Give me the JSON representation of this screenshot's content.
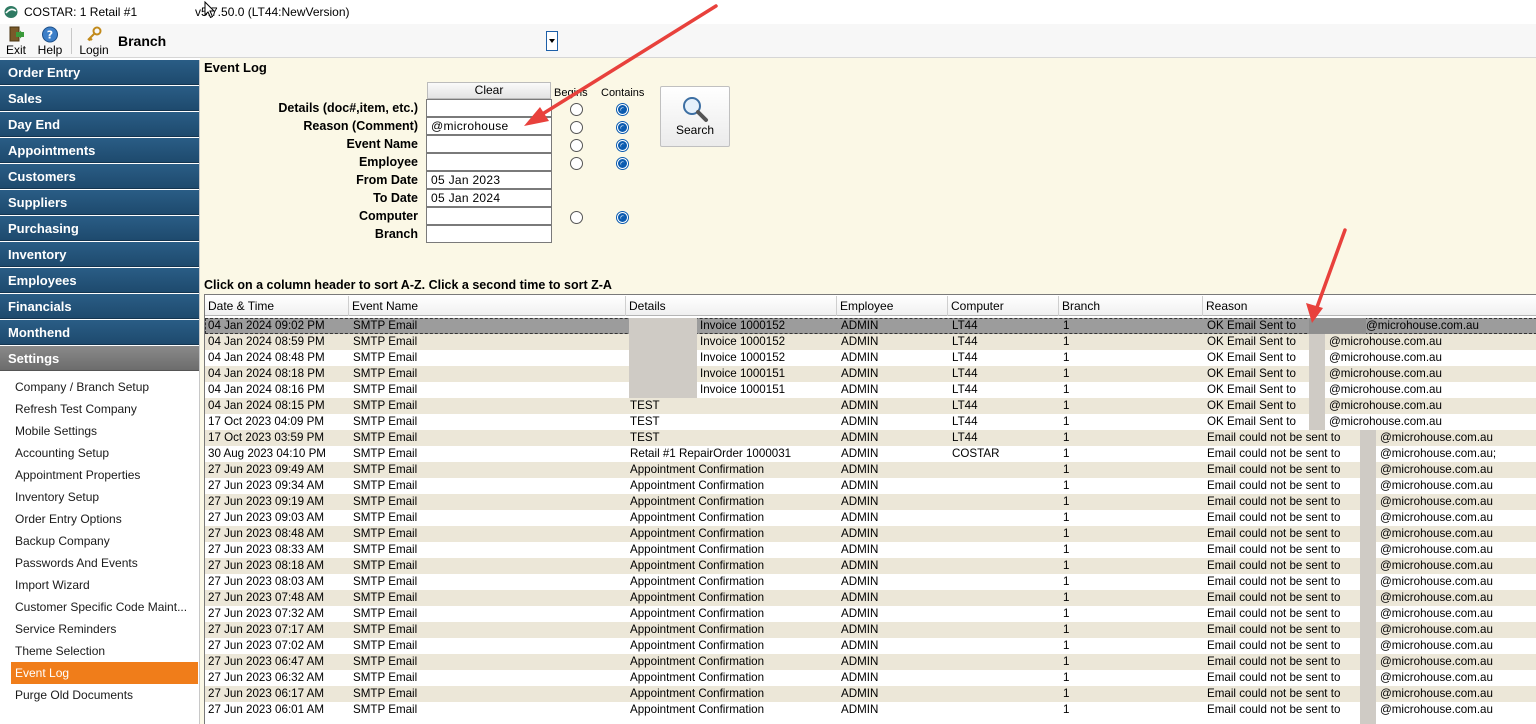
{
  "titlebar": {
    "app_name": "COSTAR:  1 Retail #1",
    "version": "v5.7.50.0  (LT44:NewVersion)"
  },
  "toolbar": {
    "exit_label": "Exit",
    "help_label": "Help",
    "login_label": "Login",
    "branch_label": "Branch"
  },
  "sidebar": {
    "headers": [
      {
        "label": "Order Entry"
      },
      {
        "label": "Sales"
      },
      {
        "label": "Day End"
      },
      {
        "label": "Appointments"
      },
      {
        "label": "Customers"
      },
      {
        "label": "Suppliers"
      },
      {
        "label": "Purchasing"
      },
      {
        "label": "Inventory"
      },
      {
        "label": "Employees"
      },
      {
        "label": "Financials"
      },
      {
        "label": "Monthend"
      },
      {
        "label": "Settings"
      }
    ],
    "settings_items": [
      {
        "label": "Company / Branch Setup"
      },
      {
        "label": "Refresh Test Company"
      },
      {
        "label": "Mobile Settings"
      },
      {
        "label": "Accounting Setup"
      },
      {
        "label": "Appointment Properties"
      },
      {
        "label": "Inventory Setup"
      },
      {
        "label": "Order Entry Options"
      },
      {
        "label": "Backup Company"
      },
      {
        "label": "Passwords And Events"
      },
      {
        "label": "Import Wizard"
      },
      {
        "label": "Customer Specific Code Maint..."
      },
      {
        "label": "Service Reminders"
      },
      {
        "label": "Theme Selection"
      },
      {
        "label": "Event Log"
      },
      {
        "label": "Purge Old Documents"
      }
    ]
  },
  "event_log": {
    "title": "Event Log",
    "clear_label": "Clear",
    "begins_label": "Begins",
    "contains_label": "Contains",
    "search_label": "Search",
    "fields": [
      {
        "label": "Details (doc#,item, etc.)",
        "value": ""
      },
      {
        "label": "Reason (Comment)",
        "value": "@microhouse"
      },
      {
        "label": "Event Name",
        "value": ""
      },
      {
        "label": "Employee",
        "value": ""
      },
      {
        "label": "From Date",
        "value": "05 Jan 2023"
      },
      {
        "label": "To Date",
        "value": "05 Jan 2024"
      },
      {
        "label": "Computer",
        "value": ""
      },
      {
        "label": "Branch",
        "value": ""
      }
    ],
    "sort_hint": "Click on a column header to sort A-Z.  Click a second time to sort Z-A"
  },
  "grid": {
    "columns": [
      "Date & Time",
      "Event Name",
      "Details",
      "Employee",
      "Computer",
      "Branch",
      "Reason"
    ],
    "rows": [
      [
        "04 Jan 2024 09:02 PM",
        "SMTP Email",
        "Invoice 1000152",
        "ADMIN",
        "LT44",
        "1",
        "OK Email Sent to",
        "@microhouse.com.au"
      ],
      [
        "04 Jan 2024 08:59 PM",
        "SMTP Email",
        "Invoice 1000152",
        "ADMIN",
        "LT44",
        "1",
        "OK Email Sent to",
        "@microhouse.com.au"
      ],
      [
        "04 Jan 2024 08:48 PM",
        "SMTP Email",
        "Invoice 1000152",
        "ADMIN",
        "LT44",
        "1",
        "OK Email Sent to",
        "@microhouse.com.au"
      ],
      [
        "04 Jan 2024 08:18 PM",
        "SMTP Email",
        "Invoice 1000151",
        "ADMIN",
        "LT44",
        "1",
        "OK Email Sent to",
        "@microhouse.com.au"
      ],
      [
        "04 Jan 2024 08:16 PM",
        "SMTP Email",
        "Invoice 1000151",
        "ADMIN",
        "LT44",
        "1",
        "OK Email Sent to",
        "@microhouse.com.au"
      ],
      [
        "04 Jan 2024 08:15 PM",
        "SMTP Email",
        "TEST",
        "ADMIN",
        "LT44",
        "1",
        "OK Email Sent to",
        "@microhouse.com.au"
      ],
      [
        "17 Oct 2023 04:09 PM",
        "SMTP Email",
        "TEST",
        "ADMIN",
        "LT44",
        "1",
        "OK Email Sent to",
        "@microhouse.com.au"
      ],
      [
        "17 Oct 2023 03:59 PM",
        "SMTP Email",
        "TEST",
        "ADMIN",
        "LT44",
        "1",
        "Email could not be sent to",
        "@microhouse.com.au"
      ],
      [
        "30 Aug 2023 04:10 PM",
        "SMTP Email",
        "Retail #1 RepairOrder 1000031",
        "ADMIN",
        "COSTAR",
        "1",
        "Email could not be sent to",
        "@microhouse.com.au;"
      ],
      [
        "27 Jun 2023 09:49 AM",
        "SMTP Email",
        "Appointment Confirmation",
        "ADMIN",
        "",
        "1",
        "Email could not be sent to",
        "@microhouse.com.au"
      ],
      [
        "27 Jun 2023 09:34 AM",
        "SMTP Email",
        "Appointment Confirmation",
        "ADMIN",
        "",
        "1",
        "Email could not be sent to",
        "@microhouse.com.au"
      ],
      [
        "27 Jun 2023 09:19 AM",
        "SMTP Email",
        "Appointment Confirmation",
        "ADMIN",
        "",
        "1",
        "Email could not be sent to",
        "@microhouse.com.au"
      ],
      [
        "27 Jun 2023 09:03 AM",
        "SMTP Email",
        "Appointment Confirmation",
        "ADMIN",
        "",
        "1",
        "Email could not be sent to",
        "@microhouse.com.au"
      ],
      [
        "27 Jun 2023 08:48 AM",
        "SMTP Email",
        "Appointment Confirmation",
        "ADMIN",
        "",
        "1",
        "Email could not be sent to",
        "@microhouse.com.au"
      ],
      [
        "27 Jun 2023 08:33 AM",
        "SMTP Email",
        "Appointment Confirmation",
        "ADMIN",
        "",
        "1",
        "Email could not be sent to",
        "@microhouse.com.au"
      ],
      [
        "27 Jun 2023 08:18 AM",
        "SMTP Email",
        "Appointment Confirmation",
        "ADMIN",
        "",
        "1",
        "Email could not be sent to",
        "@microhouse.com.au"
      ],
      [
        "27 Jun 2023 08:03 AM",
        "SMTP Email",
        "Appointment Confirmation",
        "ADMIN",
        "",
        "1",
        "Email could not be sent to",
        "@microhouse.com.au"
      ],
      [
        "27 Jun 2023 07:48 AM",
        "SMTP Email",
        "Appointment Confirmation",
        "ADMIN",
        "",
        "1",
        "Email could not be sent to",
        "@microhouse.com.au"
      ],
      [
        "27 Jun 2023 07:32 AM",
        "SMTP Email",
        "Appointment Confirmation",
        "ADMIN",
        "",
        "1",
        "Email could not be sent to",
        "@microhouse.com.au"
      ],
      [
        "27 Jun 2023 07:17 AM",
        "SMTP Email",
        "Appointment Confirmation",
        "ADMIN",
        "",
        "1",
        "Email could not be sent to",
        "@microhouse.com.au"
      ],
      [
        "27 Jun 2023 07:02 AM",
        "SMTP Email",
        "Appointment Confirmation",
        "ADMIN",
        "",
        "1",
        "Email could not be sent to",
        "@microhouse.com.au"
      ],
      [
        "27 Jun 2023 06:47 AM",
        "SMTP Email",
        "Appointment Confirmation",
        "ADMIN",
        "",
        "1",
        "Email could not be sent to",
        "@microhouse.com.au"
      ],
      [
        "27 Jun 2023 06:32 AM",
        "SMTP Email",
        "Appointment Confirmation",
        "ADMIN",
        "",
        "1",
        "Email could not be sent to",
        "@microhouse.com.au"
      ],
      [
        "27 Jun 2023 06:17 AM",
        "SMTP Email",
        "Appointment Confirmation",
        "ADMIN",
        "",
        "1",
        "Email could not be sent to",
        "@microhouse.com.au"
      ],
      [
        "27 Jun 2023 06:01 AM",
        "SMTP Email",
        "Appointment Confirmation",
        "ADMIN",
        "",
        "1",
        "Email could not be sent to",
        "@microhouse.com.au"
      ]
    ]
  },
  "colors": {
    "nav_header": "#1e4a6e",
    "nav_selected": "#f07d1a",
    "panel_bg": "#fbf8e6",
    "row_alt": "#ece7d8",
    "annotation_arrow": "#e8413c"
  }
}
